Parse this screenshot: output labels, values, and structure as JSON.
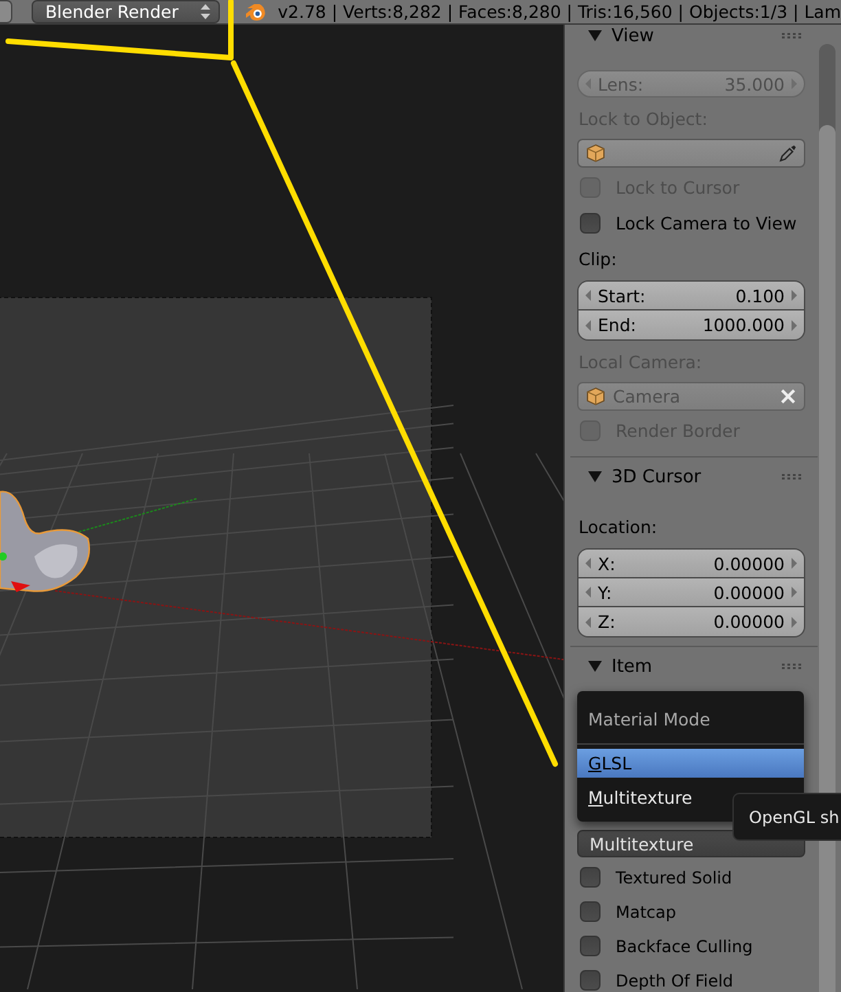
{
  "header": {
    "render_engine": "Blender Render",
    "stats": "v2.78 | Verts:8,282 | Faces:8,280 | Tris:16,560 | Objects:1/3 | Lam"
  },
  "properties": [
    {
      "kind": "section",
      "title": "View",
      "expanded": true
    },
    {
      "kind": "number",
      "label": "Lens:",
      "value": "35.000",
      "disabled": true
    },
    {
      "kind": "label",
      "text": "Lock to Object:",
      "disabled": true
    },
    {
      "kind": "object"
    },
    {
      "kind": "checkbox",
      "label": "Lock to Cursor",
      "checked": false,
      "disabled": true
    },
    {
      "kind": "checkbox",
      "label": "Lock Camera to View",
      "checked": false,
      "disabled": false
    },
    {
      "kind": "label",
      "text": "Clip:",
      "disabled": false
    },
    {
      "kind": "group",
      "fields": [
        {
          "label": "Start:",
          "value": "0.100"
        },
        {
          "label": "End:",
          "value": "1000.000"
        }
      ]
    },
    {
      "kind": "label",
      "text": "Local Camera:",
      "disabled": true
    },
    {
      "kind": "object",
      "value": "Camera",
      "disabled": true
    },
    {
      "kind": "checkbox",
      "label": "Render Border",
      "checked": false,
      "disabled": true
    },
    {
      "kind": "section",
      "title": "3D Cursor",
      "expanded": true
    },
    {
      "kind": "label",
      "text": "Location:",
      "disabled": false
    },
    {
      "kind": "group",
      "fields": [
        {
          "label": "X:",
          "value": "0.00000"
        },
        {
          "label": "Y:",
          "value": "0.00000"
        },
        {
          "label": "Z:",
          "value": "0.00000"
        }
      ]
    },
    {
      "kind": "section",
      "title": "Item",
      "expanded": true
    },
    {
      "kind": "dropdown",
      "value": "Multitexture"
    },
    {
      "kind": "checkbox",
      "label": "Textured Solid",
      "checked": false,
      "disabled": false
    },
    {
      "kind": "checkbox",
      "label": "Matcap",
      "checked": false,
      "disabled": false
    },
    {
      "kind": "checkbox",
      "label": "Backface Culling",
      "checked": false,
      "disabled": false
    },
    {
      "kind": "checkbox",
      "label": "Depth Of Field",
      "checked": false,
      "disabled": false
    }
  ],
  "menu": {
    "title": "Material Mode",
    "items": [
      {
        "label": "GLSL",
        "selected": true
      },
      {
        "label": "Multitexture",
        "selected": false
      }
    ]
  },
  "tooltip": {
    "text": "OpenGL sh"
  }
}
